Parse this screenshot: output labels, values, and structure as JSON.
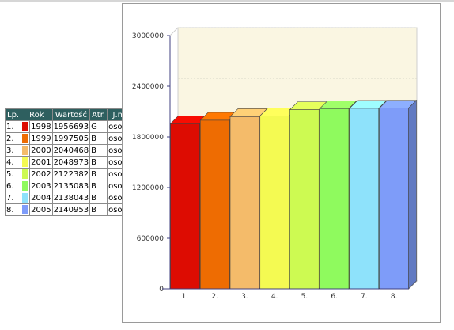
{
  "table": {
    "headers": [
      "Lp.",
      "Rok",
      "Wartość",
      "Atr.",
      "J.m."
    ],
    "rows": [
      {
        "lp": "1.",
        "color": "#dd0c02",
        "rok": "1998",
        "wartosc": "1956693",
        "atr": "G",
        "jm": "osoba"
      },
      {
        "lp": "2.",
        "color": "#ee6c02",
        "rok": "1999",
        "wartosc": "1997505",
        "atr": "B",
        "jm": "osoba"
      },
      {
        "lp": "3.",
        "color": "#f4bb6a",
        "rok": "2000",
        "wartosc": "2040468",
        "atr": "B",
        "jm": "osoba"
      },
      {
        "lp": "4.",
        "color": "#f4fa52",
        "rok": "2001",
        "wartosc": "2048973",
        "atr": "B",
        "jm": "osoba"
      },
      {
        "lp": "5.",
        "color": "#cdfa52",
        "rok": "2002",
        "wartosc": "2122382",
        "atr": "B",
        "jm": "osoba"
      },
      {
        "lp": "6.",
        "color": "#8ffa5e",
        "rok": "2003",
        "wartosc": "2135083",
        "atr": "B",
        "jm": "osoba"
      },
      {
        "lp": "7.",
        "color": "#8ee2fb",
        "rok": "2004",
        "wartosc": "2138043",
        "atr": "B",
        "jm": "osoba"
      },
      {
        "lp": "8.",
        "color": "#7e9cf9",
        "rok": "2005",
        "wartosc": "2140953",
        "atr": "B",
        "jm": "osoba"
      }
    ]
  },
  "chart_data": {
    "type": "bar",
    "categories": [
      "1.",
      "2.",
      "3.",
      "4.",
      "5.",
      "6.",
      "7.",
      "8."
    ],
    "values": [
      1956693,
      1997505,
      2040468,
      2048973,
      2122382,
      2135083,
      2138043,
      2140953
    ],
    "colors": [
      "#dd0c02",
      "#ee6c02",
      "#f4bb6a",
      "#f4fa52",
      "#cdfa52",
      "#8ffa5e",
      "#8ee2fb",
      "#7e9cf9"
    ],
    "yticks": [
      0,
      600000,
      1200000,
      1800000,
      2400000,
      3000000
    ],
    "ylim": [
      0,
      3000000
    ],
    "title": "",
    "xlabel": "",
    "ylabel": "",
    "grid": true,
    "style": "3d",
    "backwall_color": "#faf6e2"
  }
}
